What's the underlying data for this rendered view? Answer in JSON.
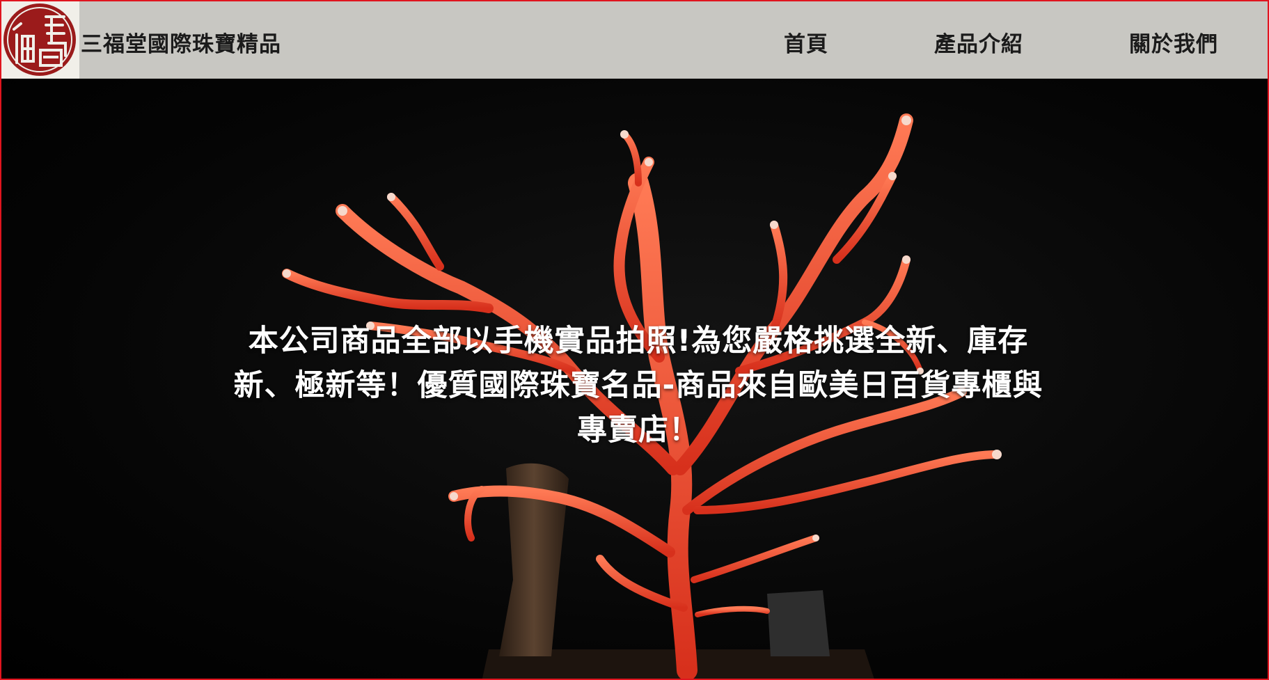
{
  "header": {
    "logo_alt": "三福堂 seal logo",
    "brand_name": "三福堂國際珠寶精品",
    "nav": [
      {
        "label": "首頁"
      },
      {
        "label": "產品介紹"
      },
      {
        "label": "關於我們"
      }
    ]
  },
  "hero": {
    "image": "red-coral-branch-image",
    "caption": "本公司商品全部以手機實品拍照!為您嚴格挑選全新、庫存新、極新等！優質國際珠寶名品-商品來自歐美日百貨專櫃與專賣店！"
  },
  "colors": {
    "nav_bg": "#c8c7c2",
    "frame_border": "#e0141e",
    "seal_red": "#9b1b1b",
    "coral": "#e8452c"
  }
}
